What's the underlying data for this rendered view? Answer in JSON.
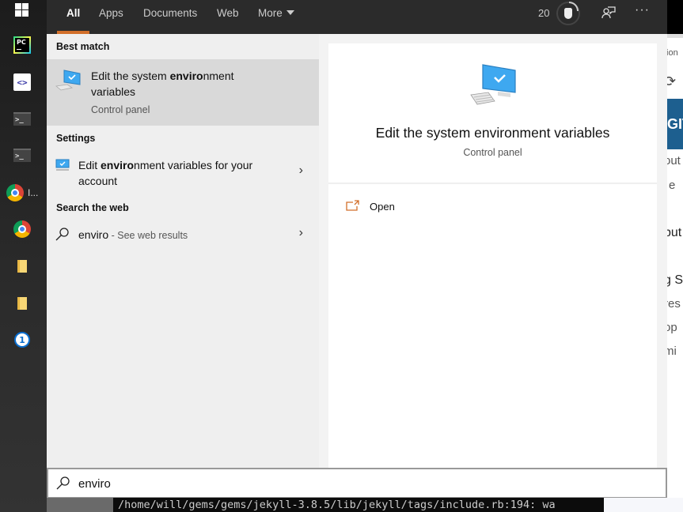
{
  "taskbar": {
    "items": [
      {
        "name": "start",
        "icon": "windows-logo-icon"
      },
      {
        "name": "pycharm",
        "icon": "pycharm-icon"
      },
      {
        "name": "code-editor",
        "icon": "code-brackets-icon"
      },
      {
        "name": "terminal-1",
        "icon": "terminal-icon"
      },
      {
        "name": "terminal-2",
        "icon": "terminal-icon"
      },
      {
        "name": "chrome-1",
        "icon": "chrome-icon",
        "label": "I..."
      },
      {
        "name": "chrome-2",
        "icon": "chrome-icon"
      },
      {
        "name": "explorer-1",
        "icon": "folder-icon"
      },
      {
        "name": "explorer-2",
        "icon": "folder-icon"
      },
      {
        "name": "1password",
        "icon": "1password-icon"
      }
    ]
  },
  "topbar": {
    "tabs": [
      {
        "label": "All",
        "active": true
      },
      {
        "label": "Apps"
      },
      {
        "label": "Documents"
      },
      {
        "label": "Web"
      },
      {
        "label": "More"
      }
    ],
    "points": "20",
    "accent": "#d26f2a"
  },
  "results": {
    "best_match_header": "Best match",
    "best_match": {
      "title_pre": "Edit the system ",
      "title_bold": "enviro",
      "title_post": "nment",
      "title_line2": "variables",
      "subtitle": "Control panel"
    },
    "settings_header": "Settings",
    "settings_item": {
      "title_pre": "Edit ",
      "title_bold": "enviro",
      "title_post": "nment variables for your",
      "title_line2": "account"
    },
    "web_header": "Search the web",
    "web_item": {
      "query": "enviro",
      "suffix": " - See web results"
    }
  },
  "preview": {
    "title": "Edit the system environment variables",
    "subtitle": "Control panel",
    "actions": [
      {
        "label": "Open",
        "icon": "open-external-icon"
      }
    ]
  },
  "search": {
    "value": "enviro"
  },
  "background": {
    "terminal_text": "/home/will/gems/gems/jekyll-3.8.5/lib/jekyll/tags/include.rb:194: wa",
    "browser_fragments": [
      "tion",
      "GIT",
      "out",
      "e",
      "but",
      "g S",
      "res",
      "op",
      "mi"
    ]
  }
}
